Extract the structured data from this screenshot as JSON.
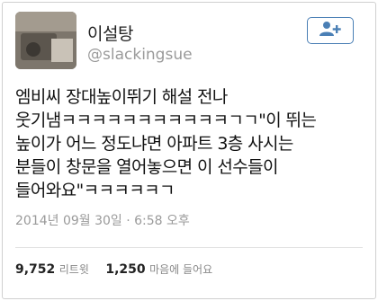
{
  "profile": {
    "name": "이설탕",
    "handle": "@slackingsue"
  },
  "tweet": {
    "lines": [
      "엠비씨 장대높이뛰기 해설 전나",
      "웃기냄ㅋㅋㅋㅋㅋㅋㅋㅋㅋㅋㅋㄱㄱ\"이 뛰는",
      "높이가 어느 정도냐면 아파트 3층 사시는",
      "분들이 창문을 열어놓으면 이 선수들이",
      "들어와요\"ㅋㅋㅋㅋㅋㄱ"
    ],
    "timestamp": "2014년 09월 30일 · 6:58 오후"
  },
  "stats": {
    "retweets_count": "9,752",
    "retweets_label": "리트윗",
    "favorites_count": "1,250",
    "favorites_label": "마음에 들어요"
  },
  "icons": {
    "follow": "add-user-icon"
  },
  "colors": {
    "accent": "#4a7fb5"
  }
}
